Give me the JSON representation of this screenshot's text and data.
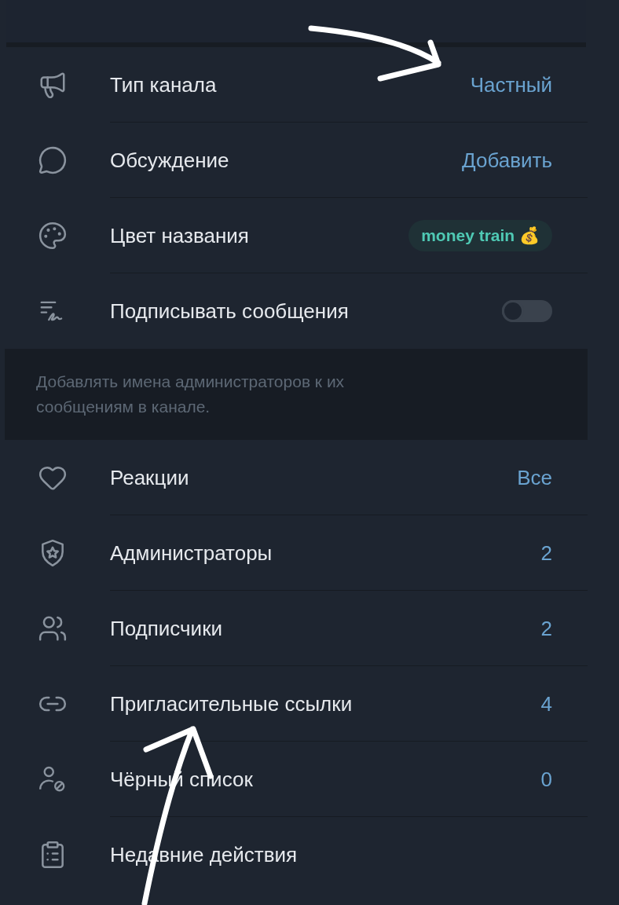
{
  "sections": [
    {
      "rows": [
        {
          "kind": "value",
          "label": "Тип канала",
          "value": "Частный"
        },
        {
          "kind": "value",
          "label": "Обсуждение",
          "value": "Добавить"
        },
        {
          "kind": "tag",
          "label": "Цвет названия",
          "value": "money train 💰",
          "color": "#4fc9b4"
        },
        {
          "kind": "toggle",
          "label": "Подписывать сообщения",
          "on": false
        }
      ],
      "note": "Добавлять имена администраторов к их сообщениям в канале."
    },
    {
      "rows": [
        {
          "kind": "value",
          "label": "Реакции",
          "value": "Все"
        },
        {
          "kind": "value",
          "label": "Администраторы",
          "value": "2"
        },
        {
          "kind": "value",
          "label": "Подписчики",
          "value": "2"
        },
        {
          "kind": "value",
          "label": "Пригласительные ссылки",
          "value": "4"
        },
        {
          "kind": "value",
          "label": "Чёрный список",
          "value": "0"
        },
        {
          "kind": "plain",
          "label": "Недавние действия"
        }
      ]
    }
  ]
}
